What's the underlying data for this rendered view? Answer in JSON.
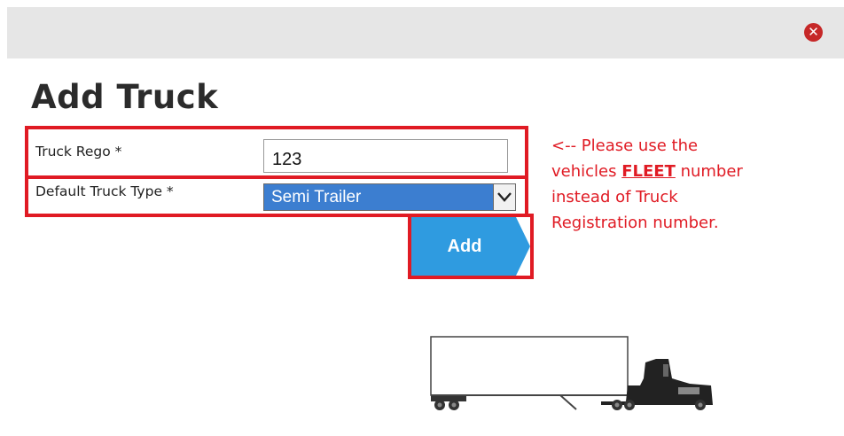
{
  "header": {
    "close_icon": "close-circle-icon",
    "close_color": "#c62828",
    "bar_color": "#e6e6e6"
  },
  "title": "Add Truck",
  "form": {
    "rego": {
      "label": "Truck Rego *",
      "value": "123"
    },
    "type": {
      "label": "Default Truck Type *",
      "selected": "Semi Trailer"
    },
    "add_label": "Add"
  },
  "note": {
    "line1": "<-- Please use the",
    "line2_pre": "vehicles ",
    "line2_bold": "FLEET",
    "line2_post": " number",
    "line3": "instead of Truck",
    "line4": "Registration number."
  },
  "illustration": {
    "icon": "semi-truck-icon"
  },
  "colors": {
    "highlight": "#e01b24",
    "accent": "#3c7ed0",
    "button": "#2f9be0",
    "note_text": "#e01b24"
  }
}
